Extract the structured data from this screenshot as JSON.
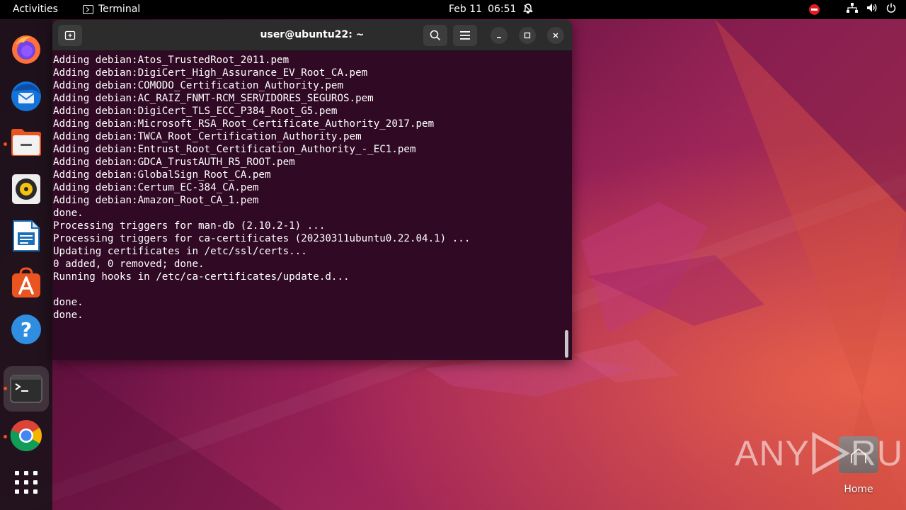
{
  "topbar": {
    "activities": "Activities",
    "app_name": "Terminal",
    "date": "Feb 11",
    "time": "06:51"
  },
  "dock": {
    "items": [
      {
        "name": "firefox",
        "icon": "firefox-icon"
      },
      {
        "name": "thunderbird",
        "icon": "thunderbird-icon"
      },
      {
        "name": "files",
        "icon": "files-icon"
      },
      {
        "name": "rhythmbox",
        "icon": "rhythmbox-icon"
      },
      {
        "name": "writer",
        "icon": "writer-icon"
      },
      {
        "name": "software",
        "icon": "app-center-icon"
      },
      {
        "name": "help",
        "icon": "help-icon"
      },
      {
        "name": "terminal",
        "icon": "terminal-icon"
      },
      {
        "name": "chrome",
        "icon": "chrome-icon"
      },
      {
        "name": "show-apps",
        "icon": "app-grid-icon"
      }
    ]
  },
  "terminal": {
    "title": "user@ubuntu22: ~",
    "lines": [
      "Adding debian:Atos_TrustedRoot_2011.pem",
      "Adding debian:DigiCert_High_Assurance_EV_Root_CA.pem",
      "Adding debian:COMODO_Certification_Authority.pem",
      "Adding debian:AC_RAIZ_FNMT-RCM_SERVIDORES_SEGUROS.pem",
      "Adding debian:DigiCert_TLS_ECC_P384_Root_G5.pem",
      "Adding debian:Microsoft_RSA_Root_Certificate_Authority_2017.pem",
      "Adding debian:TWCA_Root_Certification_Authority.pem",
      "Adding debian:Entrust_Root_Certification_Authority_-_EC1.pem",
      "Adding debian:GDCA_TrustAUTH_R5_ROOT.pem",
      "Adding debian:GlobalSign_Root_CA.pem",
      "Adding debian:Certum_EC-384_CA.pem",
      "Adding debian:Amazon_Root_CA_1.pem",
      "done.",
      "Processing triggers for man-db (2.10.2-1) ...",
      "Processing triggers for ca-certificates (20230311ubuntu0.22.04.1) ...",
      "Updating certificates in /etc/ssl/certs...",
      "0 added, 0 removed; done.",
      "Running hooks in /etc/ca-certificates/update.d...",
      "",
      "done.",
      "done."
    ]
  },
  "desktop": {
    "home_label": "Home",
    "watermark": "ANY RUN"
  },
  "colors": {
    "terminal_bg": "#300a24",
    "accent": "#e95420"
  }
}
